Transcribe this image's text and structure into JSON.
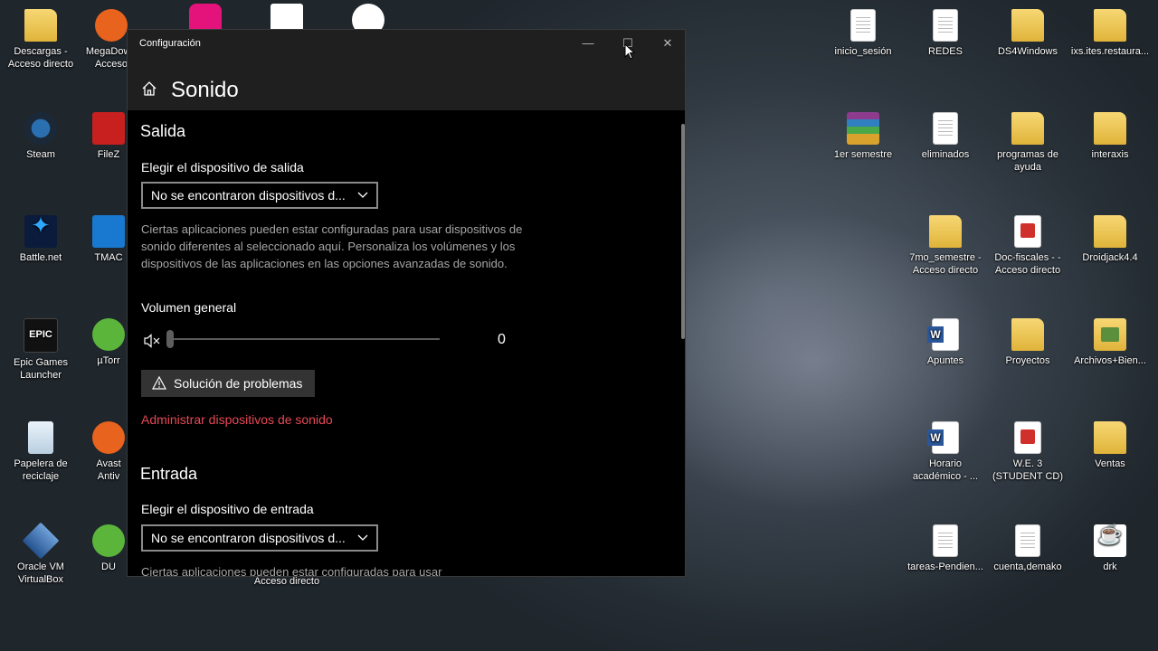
{
  "desktop": {
    "icons_left": [
      {
        "label": "Descargas - Acceso directo",
        "icon": "folder-download-icon"
      },
      {
        "label": "MegaDow - Acceso",
        "icon": "mega-icon"
      },
      {
        "label": "Steam",
        "icon": "steam-icon"
      },
      {
        "label": "FileZ",
        "icon": "filezilla-icon"
      },
      {
        "label": "Battle.net",
        "icon": "battlenet-icon"
      },
      {
        "label": "TMAC",
        "icon": "tmac-icon"
      },
      {
        "label": "Epic Games Launcher",
        "icon": "epic-games-icon"
      },
      {
        "label": "µTorr",
        "icon": "utorrent-icon"
      },
      {
        "label": "Papelera de reciclaje",
        "icon": "recycle-bin-icon"
      },
      {
        "label": "Avast Antiv",
        "icon": "avast-icon"
      },
      {
        "label": "Oracle VM VirtualBox",
        "icon": "virtualbox-icon"
      },
      {
        "label": "DU",
        "icon": "du-icon"
      }
    ],
    "icons_right": [
      {
        "label": "inicio_sesión",
        "icon": "document-icon"
      },
      {
        "label": "REDES",
        "icon": "document-icon"
      },
      {
        "label": "DS4Windows",
        "icon": "folder-icon"
      },
      {
        "label": "ixs.ites.restaura...",
        "icon": "folder-icon"
      },
      {
        "label": "1er semestre",
        "icon": "winrar-icon"
      },
      {
        "label": "eliminados",
        "icon": "document-icon"
      },
      {
        "label": "programas de ayuda",
        "icon": "folder-icon"
      },
      {
        "label": "interaxis",
        "icon": "folder-icon"
      },
      {
        "label": "7mo_semestre - Acceso directo",
        "icon": "folder-shortcut-icon"
      },
      {
        "label": "Doc-fiscales - - Acceso directo",
        "icon": "pdf-icon"
      },
      {
        "label": "Droidjack4.4",
        "icon": "folder-icon"
      },
      {
        "label": "Apuntes",
        "icon": "word-icon"
      },
      {
        "label": "Proyectos",
        "icon": "folder-icon"
      },
      {
        "label": "Archivos+Bien...",
        "icon": "folder-image-icon"
      },
      {
        "label": "Horario académico - ...",
        "icon": "word-icon"
      },
      {
        "label": "W.E. 3 (STUDENT CD)",
        "icon": "pdf-icon"
      },
      {
        "label": "Ventas",
        "icon": "folder-icon"
      },
      {
        "label": "tareas-Pendien...",
        "icon": "document-icon"
      },
      {
        "label": "cuenta,demako",
        "icon": "document-icon"
      },
      {
        "label": "drk",
        "icon": "java-icon"
      }
    ],
    "partial_label": "Acceso directo"
  },
  "window": {
    "title": "Configuración",
    "page_title": "Sonido",
    "controls": {
      "minimize": "—",
      "maximize": "☐",
      "close": "✕"
    }
  },
  "output": {
    "section_title": "Salida",
    "device_label": "Elegir el dispositivo de salida",
    "device_value": "No se encontraron dispositivos d...",
    "help_text": "Ciertas aplicaciones pueden estar configuradas para usar dispositivos de sonido diferentes al seleccionado aquí. Personaliza los volúmenes y los dispositivos de las aplicaciones en las opciones avanzadas de sonido.",
    "volume_label": "Volumen general",
    "volume_value": "0",
    "troubleshoot_label": "Solución de problemas",
    "manage_link": "Administrar dispositivos de sonido"
  },
  "input": {
    "section_title": "Entrada",
    "device_label": "Elegir el dispositivo de entrada",
    "device_value": "No se encontraron dispositivos d...",
    "help_text_partial": "Ciertas aplicaciones pueden estar configuradas para usar"
  },
  "colors": {
    "accent_link": "#e74856",
    "window_bg": "#000000",
    "titlebar_bg": "#1f1f1f",
    "secondary_text": "#a6a6a6"
  }
}
